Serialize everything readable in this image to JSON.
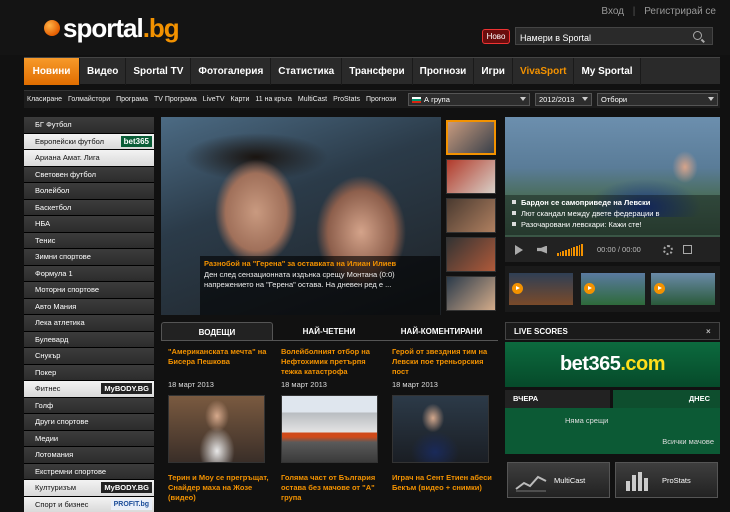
{
  "header": {
    "logo_main": "sportal",
    "logo_tld": ".bg",
    "login": "Вход",
    "register": "Регистрирай се",
    "separator": "|",
    "new_badge": "Ново",
    "search_placeholder": "Намери в Sportal"
  },
  "main_nav": [
    "Новини",
    "Видео",
    "Sportal TV",
    "Фотогалерия",
    "Статистика",
    "Трансфери",
    "Прогнози",
    "Игри",
    "VivaSport",
    "My Sportal"
  ],
  "sub_nav": [
    "Класиране",
    "Голмайстори",
    "Програма",
    "TV Програма",
    "LiveTV",
    "Карти",
    "11 на кръга",
    "MultiCast",
    "ProStats",
    "Прогнози"
  ],
  "filters": {
    "league": "А група",
    "season": "2012/2013",
    "team": "Отбори"
  },
  "sidebar": [
    {
      "label": "БГ Футбол"
    },
    {
      "label": "Европейски футбол",
      "logo": "bet365"
    },
    {
      "label": "Ариана Aмат. Лига"
    },
    {
      "label": "Световен футбол"
    },
    {
      "label": "Волейбол"
    },
    {
      "label": "Баскетбол"
    },
    {
      "label": "НБА"
    },
    {
      "label": "Тенис"
    },
    {
      "label": "Зимни спортове"
    },
    {
      "label": "Формула 1"
    },
    {
      "label": "Моторни спортове"
    },
    {
      "label": "Авто Мания"
    },
    {
      "label": "Лека атлетика"
    },
    {
      "label": "Булевард"
    },
    {
      "label": "Снукър"
    },
    {
      "label": "Покер"
    },
    {
      "label": "Фитнес",
      "logo": "MyBODY.BG"
    },
    {
      "label": "Голф"
    },
    {
      "label": "Други спортове"
    },
    {
      "label": "Медии"
    },
    {
      "label": "Лотомания"
    },
    {
      "label": "Екстремни спортове"
    },
    {
      "label": "Културизъм",
      "logo": "MyBODY.BG"
    },
    {
      "label": "Спорт и бизнес",
      "logo": "PROFIT.bg"
    }
  ],
  "featured": {
    "title": "Разнобой на \"Герена\" за оставката на Илиан Илиев",
    "desc": "Ден след сензационната издънка срещу Монтана (0:0) напрежението на \"Герена\" остава. На дневен ред е ..."
  },
  "video": {
    "lines": [
      "Бардон се самоприведе на Левски",
      "Лют скандал между двете федерации в",
      "Разочаровани левскари: Кажи сте!"
    ],
    "time": "00:00 / 00:00"
  },
  "news_tabs": [
    "ВОДЕЩИ",
    "НАЙ-ЧЕТЕНИ",
    "НАЙ-КОМЕНТИРАНИ"
  ],
  "news": [
    {
      "headline": "\"Американската мечта\" на Бисера Пешкова",
      "date": "18 март 2013",
      "headline2": "Терин и Моу се прегръщат, Снайдер маха на Жозе (видео)"
    },
    {
      "headline": "Волейболният отбор на Нефтохимик претърпя тежка катастрофа",
      "date": "18 март 2013",
      "headline2": "Голяма част от България остава без мачове от \"А\" група"
    },
    {
      "headline": "Герой от звездния тим на Левски пое треньорския пост",
      "date": "18 март 2013",
      "headline2": "Играч на Сент Етиен абеси Бекъм (видео + снимки)"
    }
  ],
  "live": {
    "title": "LIVE SCORES",
    "close": "×",
    "banner_main": "bet365",
    "banner_tld": ".com",
    "tab_yesterday": "ВЧЕРА",
    "tab_today": "ДНЕС",
    "no_matches": "Няма срещи",
    "all_matches": "Всички мачове"
  },
  "tools": [
    "MultiCast",
    "ProStats"
  ],
  "colors": {
    "accent": "#f39200",
    "bet_green": "#0c6a3e",
    "nav_active": "#f08a1c"
  }
}
